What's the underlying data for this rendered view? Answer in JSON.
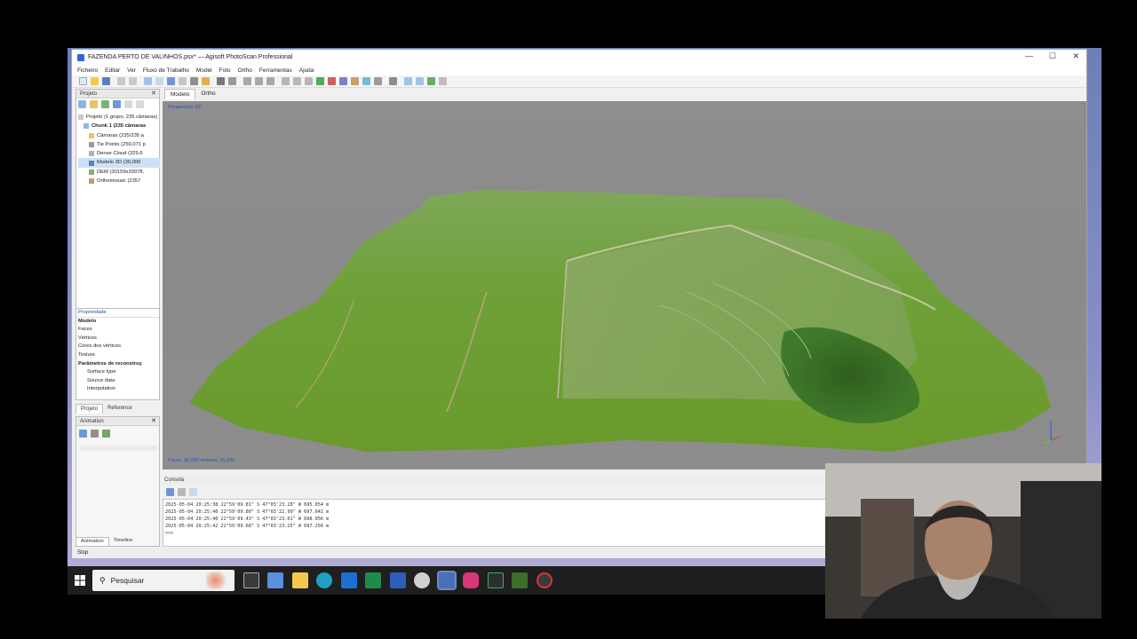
{
  "window": {
    "title": "FAZENDA PERTO DE VALINHOS.psx* — Agisoft PhotoScan Professional",
    "controls": {
      "minimize": "—",
      "maximize": "☐",
      "close": "✕"
    }
  },
  "menu": [
    "Ficheiro",
    "Editar",
    "Ver",
    "Fluxo de Trabalho",
    "Model",
    "Foto",
    "Ortho",
    "Ferramentas",
    "Ajuda"
  ],
  "project_panel": {
    "title": "Projeto",
    "tree": [
      {
        "label": "Projeto (1 grupo, 235 câmaras)",
        "icon": "project-icon",
        "indent": 0
      },
      {
        "label": "Chunk 1 (235 câmaras",
        "icon": "chunk-icon",
        "indent": 1,
        "bold": true
      },
      {
        "label": "Câmaras (235/235 a",
        "icon": "folder-icon",
        "indent": 2
      },
      {
        "label": "Tie Points (259,071 p",
        "icon": "points-icon",
        "indent": 2
      },
      {
        "label": "Dense Cloud (329,6",
        "icon": "cloud-icon",
        "indent": 2
      },
      {
        "label": "Modelo 3D (30,000",
        "icon": "mesh-icon",
        "indent": 2,
        "selected": true
      },
      {
        "label": "DEM (30159x29978,",
        "icon": "dem-icon",
        "indent": 2
      },
      {
        "label": "Orthomosaic (2357",
        "icon": "ortho-icon",
        "indent": 2
      }
    ]
  },
  "properties_panel": {
    "rows": [
      {
        "label": "Propriedade",
        "style": "header"
      },
      {
        "label": "Modelo",
        "style": "bold"
      },
      {
        "label": "Faces",
        "style": "normal"
      },
      {
        "label": "Vértices",
        "style": "normal"
      },
      {
        "label": "Cores dos vértices",
        "style": "normal"
      },
      {
        "label": "Texture",
        "style": "normal"
      },
      {
        "label": "Parâmetros de reconstruç",
        "style": "bold"
      },
      {
        "label": "Surface type",
        "style": "indent"
      },
      {
        "label": "Source data",
        "style": "indent"
      },
      {
        "label": "Interpolation",
        "style": "indent"
      }
    ],
    "tabs": [
      "Projeto",
      "Reference"
    ]
  },
  "animation_panel": {
    "title": "Animation",
    "tabs": [
      "Animation",
      "Timeline"
    ]
  },
  "viewport": {
    "tabs": [
      "Modelo",
      "Ortho"
    ],
    "perspective": "Perspective 30°",
    "footer": "Faces: 30,000 vertices: 15,200"
  },
  "console": {
    "title": "Consola",
    "lines": [
      "2025-05-04 20:25:38 22°59'09.81\" S  47°03'23.28\" W  695.054 m",
      "2025-05-04 20:25:40 22°59'09.80\" S  47°03'22.99\" W  697.641 m",
      "2025-05-04 20:25:40 22°59'09.43\" S  47°03'23.01\" W  698.056 m",
      "2025-05-04 20:25:42 22°59'09.68\" S  47°03'23.25\" W  697.256 m",
      ">>>"
    ]
  },
  "status": "Stop",
  "taskbar": {
    "search_placeholder": "Pesquisar",
    "apps": [
      "task-view-icon",
      "store-icon",
      "file-explorer-icon",
      "edge-icon",
      "outlook-icon",
      "excel-icon",
      "word-icon",
      "feather-icon",
      "photoscan-icon",
      "instagram-icon",
      "terminal-icon",
      "nvidia-icon",
      "record-icon"
    ]
  },
  "colors": {
    "accent": "#2b6bd1",
    "selection": "#cde0f7",
    "viewport_bg": "#8c8c8c",
    "terrain_green": "#5f9a2e"
  }
}
